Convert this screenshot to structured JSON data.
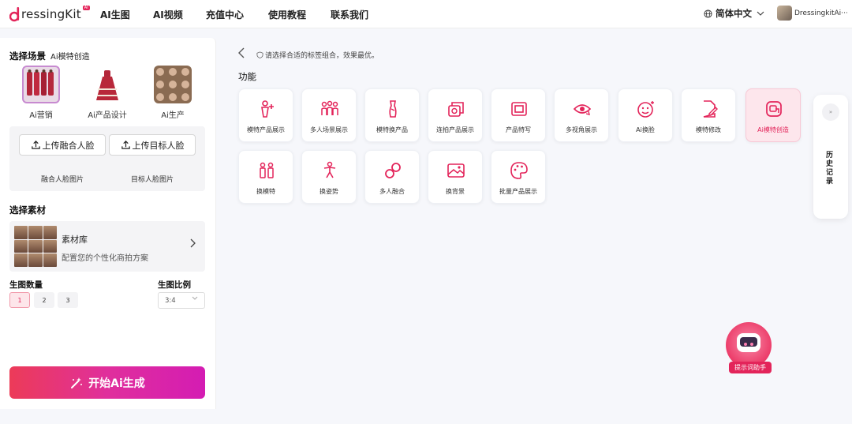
{
  "header": {
    "logo_text": "ressingKit",
    "logo_badge": "AI",
    "nav": [
      "AI生图",
      "AI视频",
      "充值中心",
      "使用教程",
      "联系我们"
    ],
    "language": "简体中文",
    "username": "DressingkitAi···"
  },
  "left": {
    "scene_title": "选择场景",
    "scene_subtitle": "Ai模特创造",
    "scenes": [
      "Ai营销",
      "Ai产品设计",
      "Ai生产"
    ],
    "upload_fuse": "上传融合人脸",
    "upload_target": "上传目标人脸",
    "fuse_label": "融合人脸图片",
    "target_label": "目标人脸图片",
    "material_title": "选择素材",
    "library_title": "素材库",
    "library_desc": "配置您的个性化商拍方案",
    "count_title": "生图数量",
    "counts": [
      "1",
      "2",
      "3"
    ],
    "count_selected": "1",
    "ratio_title": "生图比例",
    "ratio_value": "3:4",
    "generate_label": "开始Ai生成"
  },
  "main": {
    "hint": "请选择合适的标签组合，效果最优。",
    "function_title": "功能",
    "functions": [
      "模特产品展示",
      "多人场景展示",
      "模特换产品",
      "连拍产品展示",
      "产品特写",
      "多视角展示",
      "Ai换脸",
      "模特修改",
      "Ai模特创造",
      "换模特",
      "换姿势",
      "多人融合",
      "换背景",
      "批量产品展示"
    ],
    "active_function": "Ai模特创造"
  },
  "history": {
    "dot": "»",
    "label": "历史记录"
  },
  "assistant": {
    "label": "提示词助手"
  },
  "colors": {
    "accent": "#e3245a",
    "accent_pink": "#d41cb3"
  }
}
